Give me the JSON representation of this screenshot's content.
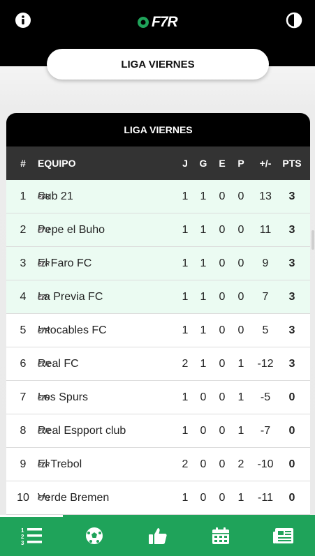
{
  "app": {
    "logo_text": "F7R"
  },
  "league": {
    "selector_label": "LIGA VIERNES",
    "table_title": "LIGA VIERNES"
  },
  "table": {
    "headers": {
      "pos": "#",
      "team": "EQUIPO",
      "j": "J",
      "g": "G",
      "e": "E",
      "p": "P",
      "dg": "+/-",
      "pts": "PTS"
    },
    "rows": [
      {
        "pos": "1",
        "team": "Sub 21",
        "j": "1",
        "g": "1",
        "e": "0",
        "p": "0",
        "dg": "13",
        "pts": "3",
        "highlight": true
      },
      {
        "pos": "2",
        "team": "Pepe el Buho",
        "j": "1",
        "g": "1",
        "e": "0",
        "p": "0",
        "dg": "11",
        "pts": "3",
        "highlight": true
      },
      {
        "pos": "3",
        "team": "El Faro FC",
        "j": "1",
        "g": "1",
        "e": "0",
        "p": "0",
        "dg": "9",
        "pts": "3",
        "highlight": true
      },
      {
        "pos": "4",
        "team": "La Previa FC",
        "j": "1",
        "g": "1",
        "e": "0",
        "p": "0",
        "dg": "7",
        "pts": "3",
        "highlight": true
      },
      {
        "pos": "5",
        "team": "Intocables FC",
        "j": "1",
        "g": "1",
        "e": "0",
        "p": "0",
        "dg": "5",
        "pts": "3",
        "highlight": false
      },
      {
        "pos": "6",
        "team": "Real FC",
        "j": "2",
        "g": "1",
        "e": "0",
        "p": "1",
        "dg": "-12",
        "pts": "3",
        "highlight": false
      },
      {
        "pos": "7",
        "team": "Los Spurs",
        "j": "1",
        "g": "0",
        "e": "0",
        "p": "1",
        "dg": "-5",
        "pts": "0",
        "highlight": false
      },
      {
        "pos": "8",
        "team": "Real Espport club",
        "j": "1",
        "g": "0",
        "e": "0",
        "p": "1",
        "dg": "-7",
        "pts": "0",
        "highlight": false
      },
      {
        "pos": "9",
        "team": "El Trebol",
        "j": "2",
        "g": "0",
        "e": "0",
        "p": "2",
        "dg": "-10",
        "pts": "0",
        "highlight": false
      },
      {
        "pos": "10",
        "team": "Verde Bremen",
        "j": "1",
        "g": "0",
        "e": "0",
        "p": "1",
        "dg": "-11",
        "pts": "0",
        "highlight": false
      }
    ]
  },
  "nav": [
    {
      "name": "standings",
      "icon": "list-ranking-icon",
      "active": true
    },
    {
      "name": "matches",
      "icon": "soccer-ball-icon",
      "active": false
    },
    {
      "name": "favorites",
      "icon": "thumbs-up-icon",
      "active": false
    },
    {
      "name": "calendar",
      "icon": "calendar-icon",
      "active": false
    },
    {
      "name": "news",
      "icon": "newspaper-icon",
      "active": false
    }
  ],
  "colors": {
    "topbar": "#000000",
    "accent": "#1fa35a",
    "header_row": "#333333",
    "highlight_row": "#ebfbf2"
  }
}
